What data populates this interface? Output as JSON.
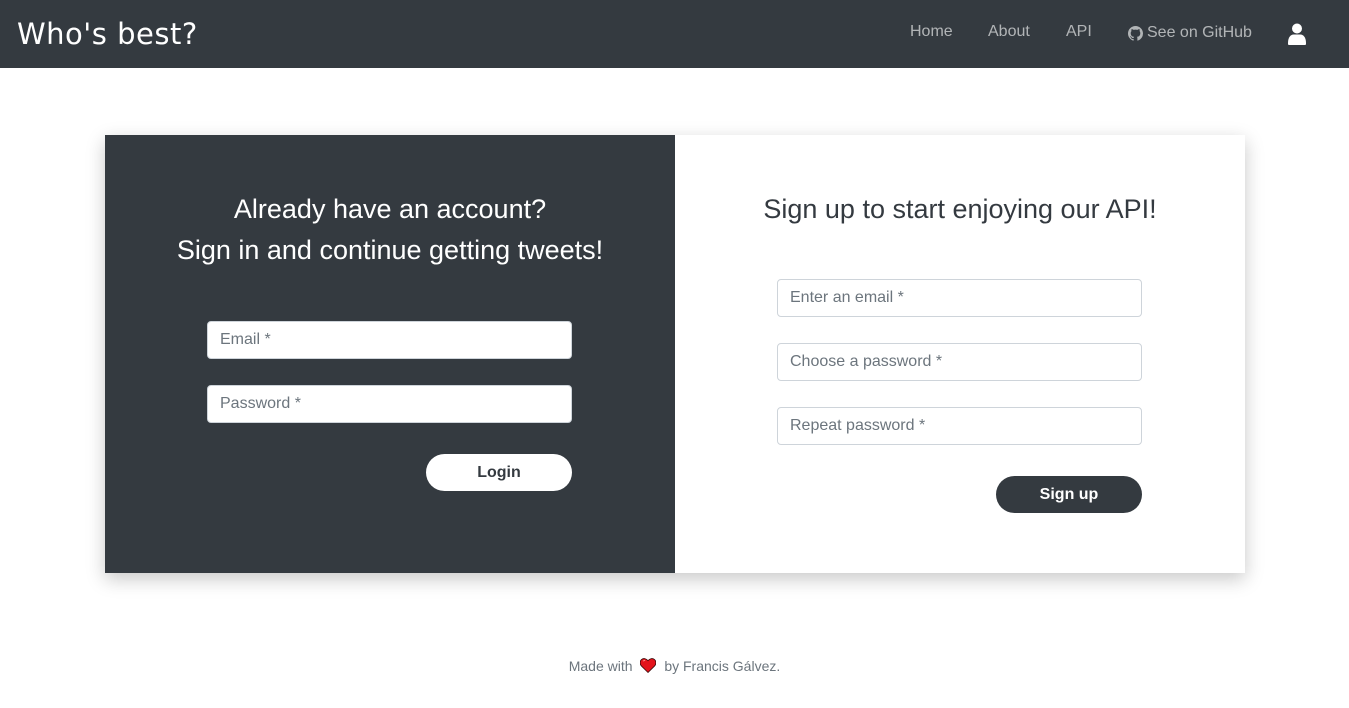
{
  "navbar": {
    "brand": "Who's best?",
    "links": [
      {
        "label": "Home"
      },
      {
        "label": "About"
      },
      {
        "label": "API"
      },
      {
        "label": "See on GitHub",
        "icon": "github-icon"
      }
    ],
    "user_icon": "user-icon",
    "background": "#343a40"
  },
  "login": {
    "heading_line1": "Already have an account?",
    "heading_line2": "Sign in and continue getting tweets!",
    "email_placeholder": "Email *",
    "password_placeholder": "Password *",
    "button_label": "Login"
  },
  "signup": {
    "heading": "Sign up to start enjoying our API!",
    "email_placeholder": "Enter an email *",
    "password_placeholder": "Choose a password *",
    "repeat_placeholder": "Repeat password *",
    "button_label": "Sign up"
  },
  "footer": {
    "prefix": "Made with",
    "suffix": "by Francis Gálvez.",
    "icon": "heart-icon"
  },
  "colors": {
    "dark": "#343a40",
    "heart": "#e3131b"
  }
}
